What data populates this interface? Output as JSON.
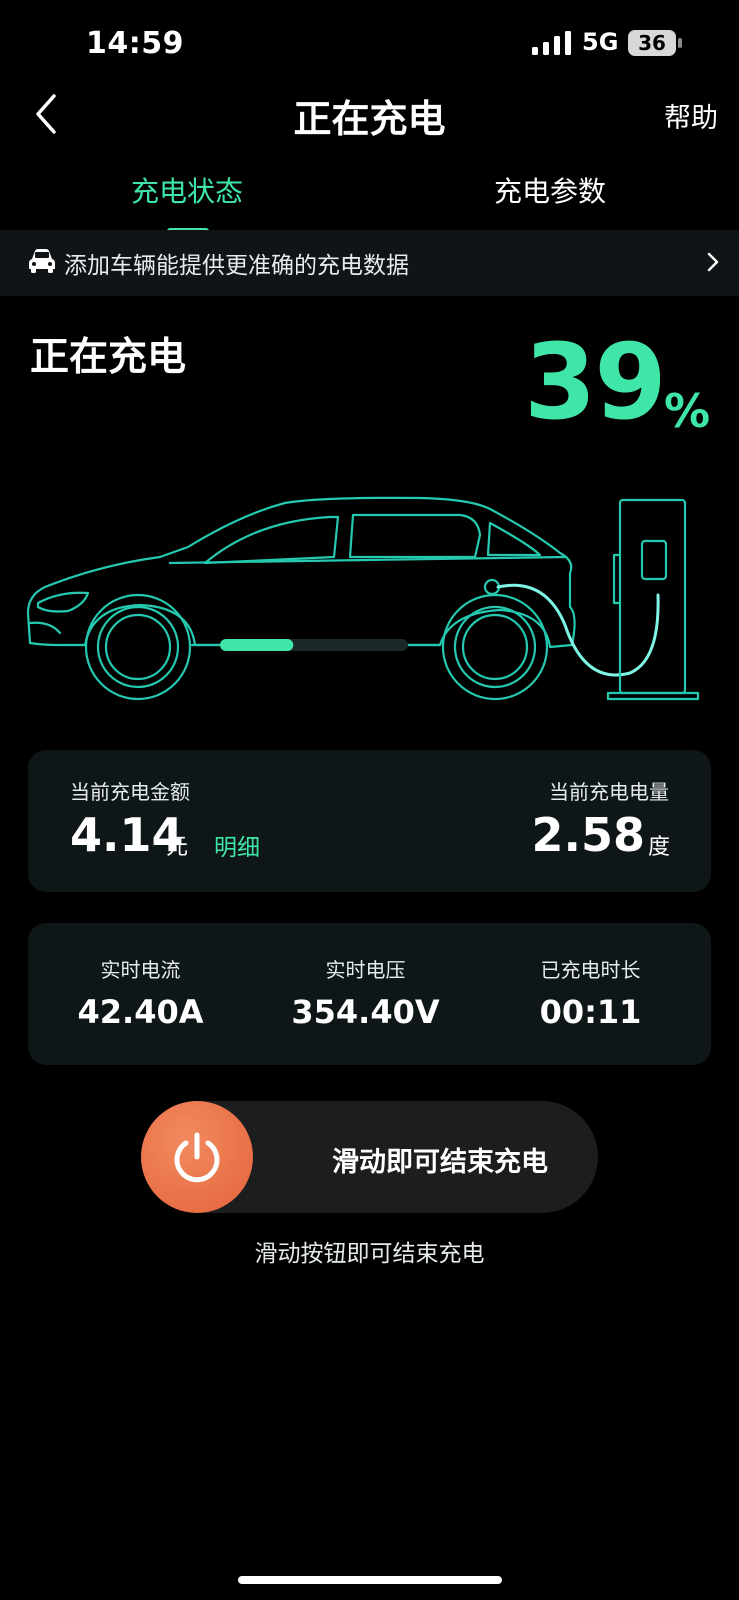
{
  "status_bar": {
    "time": "14:59",
    "network": "5G",
    "battery": "36"
  },
  "header": {
    "title": "正在充电",
    "help": "帮助"
  },
  "tabs": [
    {
      "label": "充电状态",
      "active": true
    },
    {
      "label": "充电参数",
      "active": false
    }
  ],
  "banner": {
    "text": "添加车辆能提供更准确的充电数据"
  },
  "charging": {
    "state": "正在充电",
    "percent": "39",
    "percent_unit": "%",
    "progress": 0.39
  },
  "billing": {
    "amount_label": "当前充电金额",
    "amount_value": "4.14",
    "amount_unit": "元",
    "detail_label": "明细",
    "energy_label": "当前充电电量",
    "energy_value": "2.58",
    "energy_unit": "度"
  },
  "metrics": [
    {
      "label": "实时电流",
      "value": "42.40A"
    },
    {
      "label": "实时电压",
      "value": "354.40V"
    },
    {
      "label": "已充电时长",
      "value": "00:11"
    }
  ],
  "slider": {
    "label": "滑动即可结束充电",
    "hint": "滑动按钮即可结束充电"
  },
  "colors": {
    "accent": "#3fe6a8",
    "outline": "#25c9b0",
    "stop_button": "#e8693f",
    "card": "#0f1618"
  }
}
